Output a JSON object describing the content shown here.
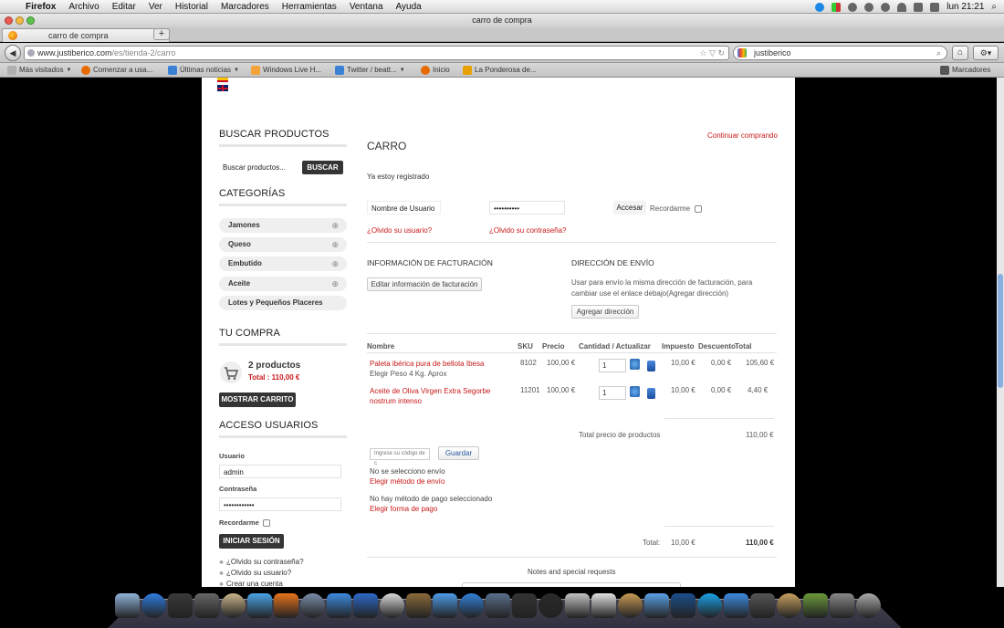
{
  "menubar": {
    "items": [
      "Firefox",
      "Archivo",
      "Editar",
      "Ver",
      "Historial",
      "Marcadores",
      "Herramientas",
      "Ventana",
      "Ayuda"
    ],
    "clock": "lun 21:21"
  },
  "window": {
    "title": "carro de compra"
  },
  "tab": {
    "title": "carro de compra",
    "new_tab": "+"
  },
  "nav": {
    "url_host": "www.justiberico.com",
    "url_path": "/es/tienda-2/carro",
    "search_value": "justiberico"
  },
  "bookmarks": [
    {
      "label": "Más visitados",
      "dropdown": true,
      "color": "#b0b0b0"
    },
    {
      "label": "Comenzar a usa...",
      "dropdown": false,
      "color": "#e66a00"
    },
    {
      "label": "Últimas noticias",
      "dropdown": true,
      "color": "#3b82d6"
    },
    {
      "label": "Windows Live H...",
      "dropdown": false,
      "color": "#f2a33a"
    },
    {
      "label": "Twitter / beatt...",
      "dropdown": true,
      "color": "#3b82d6"
    },
    {
      "label": "Inicio",
      "dropdown": false,
      "color": "#e66a00"
    },
    {
      "label": "La Ponderosa de...",
      "dropdown": false,
      "color": "#e6a000"
    }
  ],
  "bookmarks_right": "Marcadores",
  "sidebar": {
    "search_heading": "BUSCAR PRODUCTOS",
    "search_placeholder": "Buscar productos...",
    "search_button": "BUSCAR",
    "categories_heading": "CATEGORÍAS",
    "categories": [
      {
        "label": "Jamones",
        "expandable": true
      },
      {
        "label": "Queso",
        "expandable": true
      },
      {
        "label": "Embutido",
        "expandable": true
      },
      {
        "label": "Aceite",
        "expandable": true
      },
      {
        "label": "Lotes y Pequeños Placeres",
        "expandable": false
      }
    ],
    "cart_heading": "TU COMPRA",
    "cart_count": "2 productos",
    "cart_total": "Total : 110,00 €",
    "show_cart_button": "MOSTRAR CARRITO",
    "login_heading": "ACCESO USUARIOS",
    "user_label": "Usuario",
    "user_value": "admin",
    "pass_label": "Contraseña",
    "pass_value": "••••••••••••",
    "remember_label": "Recordarme",
    "login_button": "INICIAR SESIÓN",
    "links": [
      "¿Olvido su contraseña?",
      "¿Olvido su usuario?",
      "Crear una cuenta"
    ]
  },
  "cart": {
    "title": "CARRO",
    "continue_link": "Continuar comprando",
    "registered_text": "Ya estoy registrado",
    "username_placeholder": "Nombre de Usuario",
    "password_value": "••••••••••",
    "login_button": "Accesar",
    "remember_label": "Recordarme",
    "forgot_user": "¿Olvido su usuario?",
    "forgot_pass": "¿Olvido su contraseña?",
    "billing_heading": "INFORMACIÓN DE FACTURACIÓN",
    "billing_button": "Editar información de facturación",
    "shipping_heading": "DIRECCIÓN DE ENVÍO",
    "shipping_text": "Usar para envío la misma dirección de facturación, para cambiar use el enlace debajo(Agregar dirección)",
    "shipping_button": "Agregar dirección",
    "columns": [
      "Nombre",
      "SKU",
      "Precio",
      "Cantidad / Actualizar",
      "Impuesto",
      "Descuento",
      "Total"
    ],
    "rows": [
      {
        "name": "Paleta ibérica pura de bellota Ibesa",
        "variant": "Elegir Peso 4 Kg. Aprox",
        "sku": "8102",
        "price": "100,00 €",
        "qty": "1",
        "tax": "10,00 €",
        "discount": "0,00 €",
        "total": "105,60 €"
      },
      {
        "name": "Aceite de Oliva Virgen Extra Segorbe nostrum intenso",
        "variant": "",
        "sku": "11201",
        "price": "100,00 €",
        "qty": "1",
        "tax": "10,00 €",
        "discount": "0,00 €",
        "total": "4,40 €"
      }
    ],
    "products_total_label": "Total precio de productos",
    "products_total_value": "110,00 €",
    "coupon_placeholder": "Ingrese su código de c",
    "coupon_button": "Guardar",
    "no_shipping": "No se selecciono envío",
    "choose_shipping": "Elegir método de envío",
    "no_payment": "No hay método de pago seleccionado",
    "choose_payment": "Elegir forma de pago",
    "grand_total_label": "Total:",
    "grand_total_tax": "10,00 €",
    "grand_total_value": "110,00 €",
    "notes_label": "Notes and special requests"
  },
  "dock_colors": [
    "#8fb3d9",
    "#2f7de1",
    "#3a3a3a",
    "#666",
    "#c9b58a",
    "#4aa3e6",
    "#e8731a",
    "#7a8ca8",
    "#3d8ae0",
    "#2c69c8",
    "#d9d9d9",
    "#8a6a3a",
    "#4d9be6",
    "#3380d8",
    "#5a6f8a",
    "#333",
    "#2a2a2a",
    "#c0c0c0",
    "#e0e0e0",
    "#c79a55",
    "#5aa0e6",
    "#1a4f8c",
    "#1aa0e6",
    "#3d8ae0",
    "#555",
    "#c8a060",
    "#6a9a3a",
    "#888",
    "#aaa"
  ]
}
